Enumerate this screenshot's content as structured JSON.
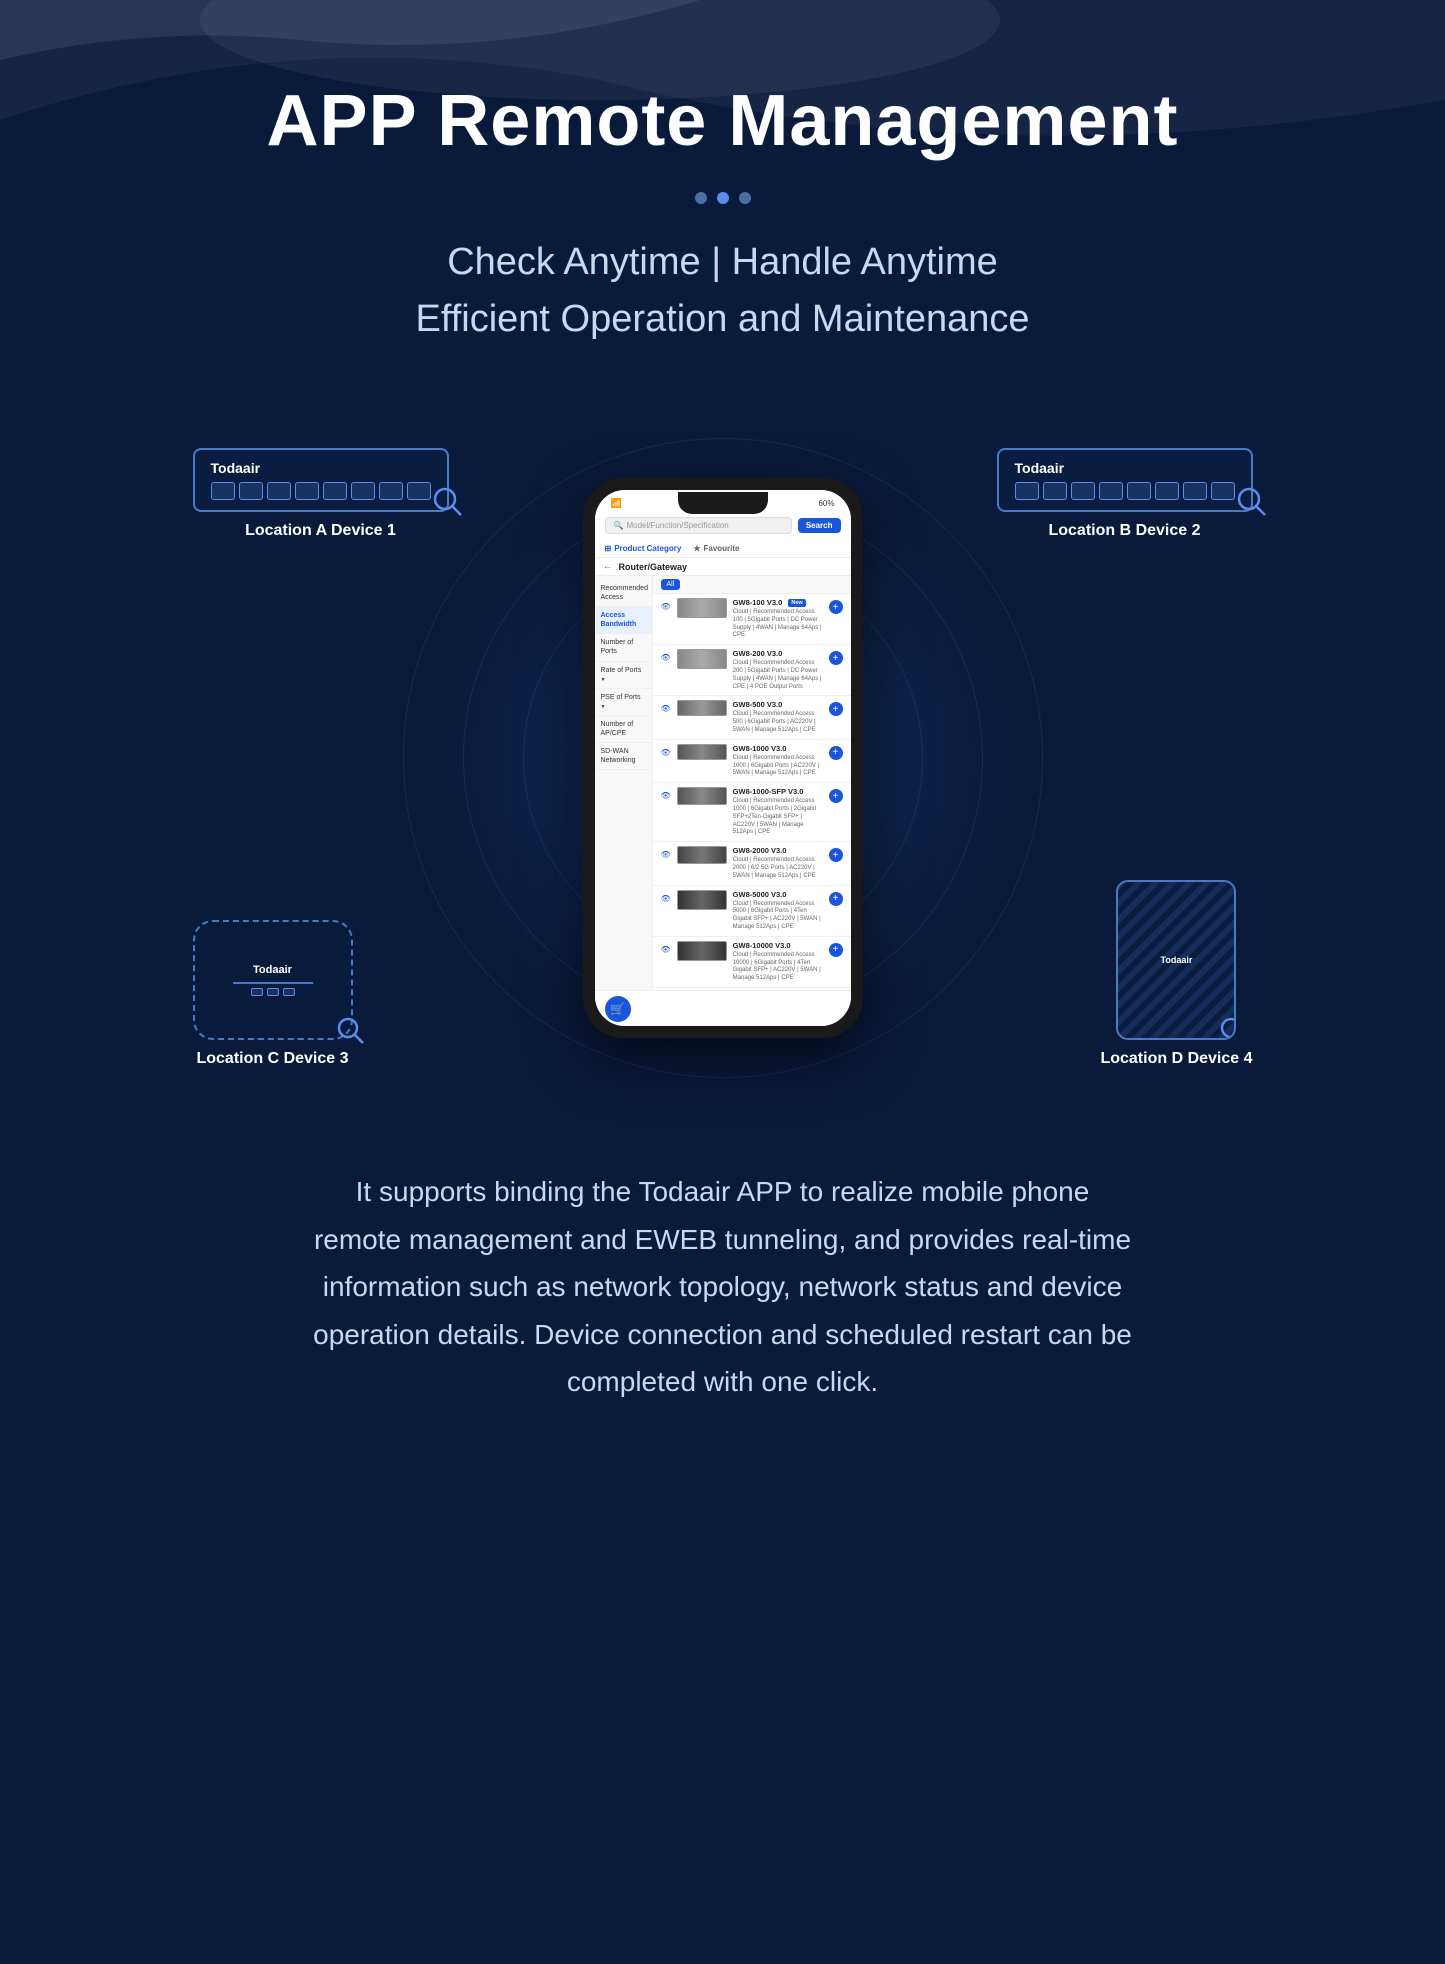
{
  "page": {
    "title": "APP Remote Management",
    "subtitle_line1": "Check Anytime | Handle Anytime",
    "subtitle_line2": "Efficient Operation and Maintenance",
    "description": "It supports binding the Todaair APP to realize mobile phone remote management and EWEB tunneling, and provides real-time information such as network topology, network status and device operation details. Device connection and scheduled restart can be completed with one click."
  },
  "dots": [
    {
      "active": false
    },
    {
      "active": true
    },
    {
      "active": false
    }
  ],
  "devices": {
    "location_a": {
      "label": "Location A Device 1",
      "logo": "Todaair"
    },
    "location_b": {
      "label": "Location B Device 2",
      "logo": "Todaair"
    },
    "location_c": {
      "label": "Location C Device 3",
      "logo": "Todaair"
    },
    "location_d": {
      "label": "Location D Device 4",
      "logo": "Todaair"
    }
  },
  "phone": {
    "battery": "60%",
    "search_placeholder": "Model/Function/Specification",
    "search_button": "Search",
    "tab_category": "Product Category",
    "tab_favourite": "Favourite",
    "category_title": "Router/Gateway",
    "sidebar": [
      {
        "label": "Recommended Access",
        "active": false
      },
      {
        "label": "Access Bandwidth",
        "active": true
      },
      {
        "label": "Number of Ports",
        "active": false
      },
      {
        "label": "Rate of Ports",
        "active": false,
        "arrow": true
      },
      {
        "label": "PSE of Ports",
        "active": false,
        "arrow": true
      },
      {
        "label": "Number of AP/CPE",
        "active": false
      },
      {
        "label": "SD-WAN Networking",
        "active": false
      }
    ],
    "all_btn": "All",
    "products": [
      {
        "name": "GW8-100 V3.0",
        "desc": "Cloud | Recommended Access 100 | 5Gigabit Ports | DC Power Supply | 4WAN | Manage 64Aps | CPE",
        "is_new": true
      },
      {
        "name": "GW8-200 V3.0",
        "desc": "Cloud | Recommended Access 200 | 5Gigabit Ports | DC Power Supply | 4WAN | Manage 64Aps | CPE | 4 POE Output Ports",
        "is_new": false
      },
      {
        "name": "GW8-500 V3.0",
        "desc": "Cloud | Recommended Access 500 | 6Gigabit Ports | AC220V | 5WAN | Manage 512Aps | CPE",
        "is_new": false
      },
      {
        "name": "GW8-1000 V3.0",
        "desc": "Cloud | Recommended Access 1000 | 6Gigabit Ports | AC220V | 5WAN | Manage 512Aps | CPE",
        "is_new": false
      },
      {
        "name": "GW8-1000-SFP V3.0",
        "desc": "Cloud | Recommended Access 1000 | 6Gigabit Ports | 2Gigabit SFP+2Ten-Gigabit SFP+ | AC220V | 5WAN | Manage 512Aps | CPE",
        "is_new": false
      },
      {
        "name": "GW8-2000 V3.0",
        "desc": "Cloud | Recommended Access 2000 | 6/2 5G Ports | AC220V | 5WAN | Manage 512Aps | CPE",
        "is_new": false
      },
      {
        "name": "GW8-5000 V3.0",
        "desc": "Cloud | Recommended Access 5000 | 6Gigabit Ports | 4Ten Gigabit SFP+ | AC220V | 5WAN | Manage 512Aps | CPE",
        "is_new": false
      },
      {
        "name": "GW8-10000 V3.0",
        "desc": "Cloud | Recommended Access 10000 | 6Gigabit Ports | 4Ten Gigabit SFP+ | AC220V | 5WAN | Manage 512Aps | CPE",
        "is_new": false
      }
    ]
  }
}
